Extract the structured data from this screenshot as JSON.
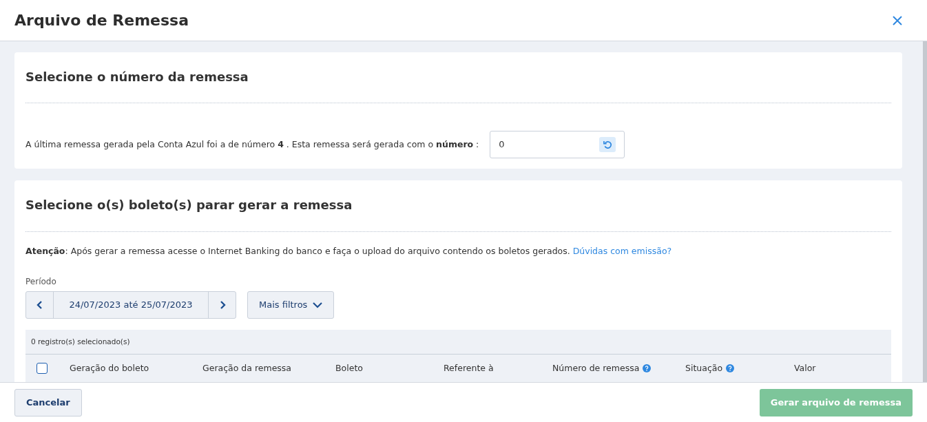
{
  "window": {
    "title": "Arquivo de Remessa"
  },
  "number_section": {
    "title": "Selecione o número da remessa",
    "sentence": "A última remessa gerada pela Conta Azul foi a de número **4** . Esta remessa será gerada com o **número** :",
    "input_value": "0"
  },
  "boletos_section": {
    "title": "Selecione o(s) boleto(s) parar gerar a remessa",
    "notice": "**Atenção**: Após gerar a remessa acesse o Internet Banking do banco e faça o upload do arquivo contendo os boletos gerados.",
    "notice_link": "Dúvidas com emissão?",
    "period_label": "Período",
    "period_value": "24/07/2023 até 25/07/2023",
    "filters_button": "Mais filtros",
    "table": {
      "selection_count": "0 registro(s) selecionado(s)",
      "select_all_checked": false,
      "columns": [
        {
          "label": "Geração do boleto",
          "help": false
        },
        {
          "label": "Geração da remessa",
          "help": false
        },
        {
          "label": "Boleto",
          "help": false
        },
        {
          "label": "Referente à",
          "help": false
        },
        {
          "label": "Número de remessa",
          "help": true
        },
        {
          "label": "Situação",
          "help": true
        },
        {
          "label": "Valor",
          "help": false
        }
      ]
    }
  },
  "footer": {
    "cancel": "Cancelar",
    "submit": "Gerar arquivo de remessa",
    "submit_disabled": true
  }
}
